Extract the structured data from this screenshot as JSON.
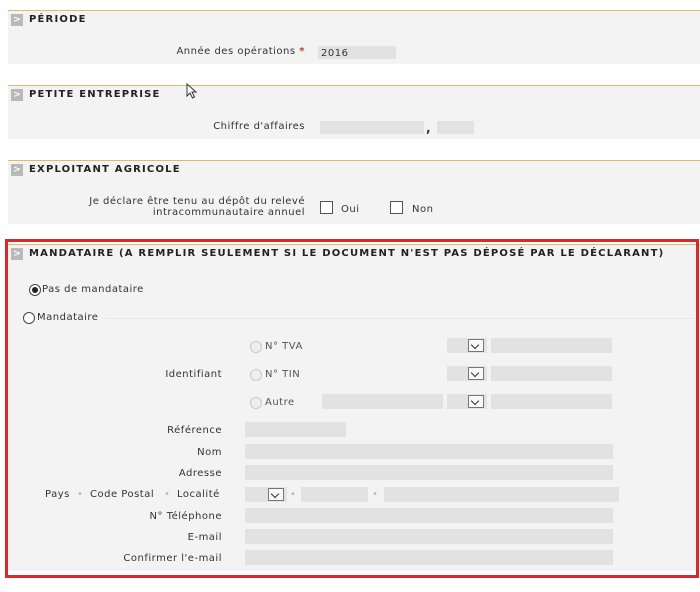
{
  "periode": {
    "title": "PÉRIODE",
    "annee_label": "Année des opérations",
    "required_mark": "*",
    "annee_value": "2016"
  },
  "petite_entreprise": {
    "title": "PETITE ENTREPRISE",
    "ca_label": "Chiffre d'affaires",
    "decimal_sep": ","
  },
  "exploitant": {
    "title": "EXPLOITANT AGRICOLE",
    "declare_label_line1": "Je déclare être tenu au dépôt du relevé",
    "declare_label_line2": "intracommunautaire annuel",
    "oui_label": "Oui",
    "non_label": "Non"
  },
  "mandataire": {
    "title": "MANDATAIRE (A REMPLIR SEULEMENT SI LE DOCUMENT N'EST PAS DÉPOSÉ PAR LE DÉCLARANT)",
    "pas_de_mandataire_label": "Pas de mandataire",
    "mandataire_label": "Mandataire",
    "identifiant_label": "Identifiant",
    "tva_label": "N° TVA",
    "tin_label": "N° TIN",
    "autre_label": "Autre",
    "reference_label": "Référence",
    "nom_label": "Nom",
    "adresse_label": "Adresse",
    "pays_label": "Pays",
    "code_postal_label": "Code Postal",
    "localite_label": "Localité",
    "sep_dot": "•",
    "telephone_label": "N° Téléphone",
    "email_label": "E-mail",
    "confirm_email_label": "Confirmer l'e-mail"
  },
  "colors": {
    "section_border": "#e5b86a",
    "highlight_box": "#d52b2b",
    "field_bg": "#e2e2e2"
  }
}
